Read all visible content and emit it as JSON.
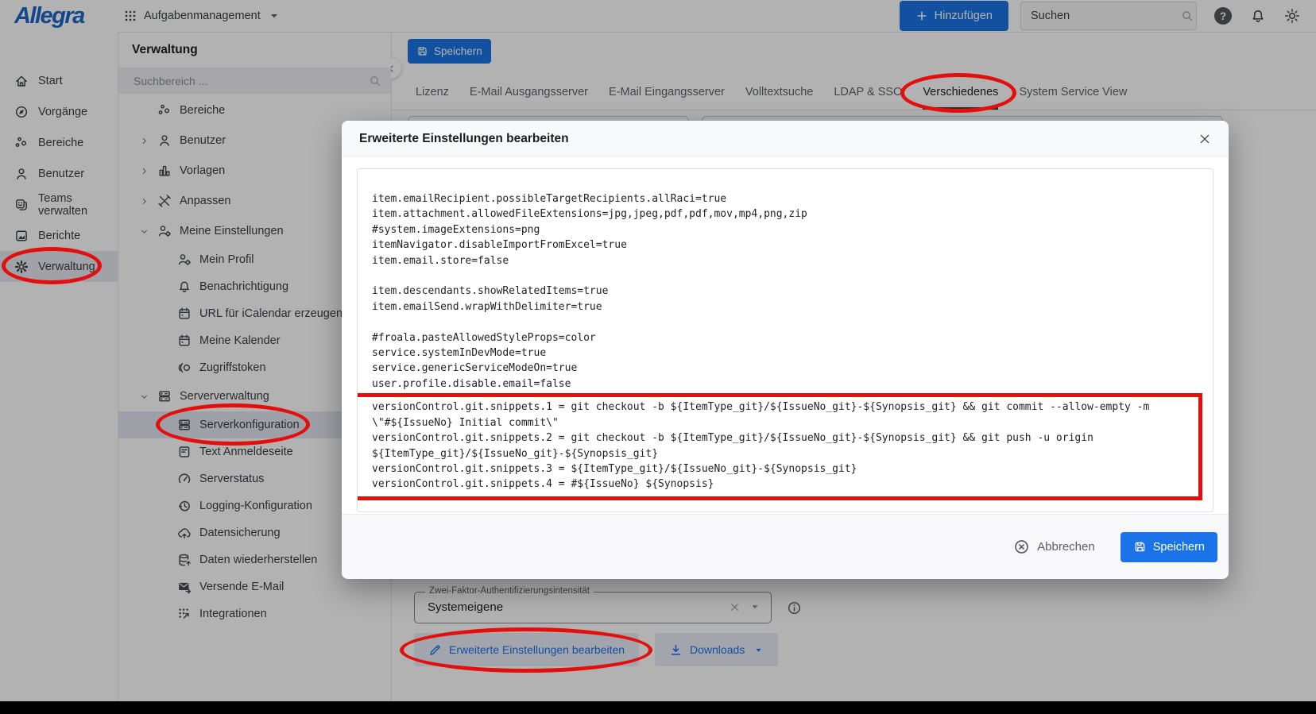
{
  "topbar": {
    "logo": "Allegra",
    "workspace_switcher": {
      "label": "Aufgabenmanagement",
      "icon": "apps-grid"
    },
    "add_button": {
      "label": "Hinzufügen",
      "icon": "plus"
    },
    "search": {
      "placeholder": "Suchen",
      "icon": "search"
    },
    "icons": [
      "help",
      "bell",
      "brightness"
    ]
  },
  "left_nav": {
    "items": [
      {
        "label": "Start",
        "icon": "home"
      },
      {
        "label": "Vorgänge",
        "icon": "compass"
      },
      {
        "label": "Bereiche",
        "icon": "dots-cluster"
      },
      {
        "label": "Benutzer",
        "icon": "person"
      },
      {
        "label": "Teams verwalten",
        "icon": "masks"
      },
      {
        "label": "Berichte",
        "icon": "report-image"
      },
      {
        "label": "Verwaltung",
        "icon": "gear",
        "selected": true
      }
    ]
  },
  "admin_panel": {
    "title": "Verwaltung",
    "search_placeholder": "Suchbereich ...",
    "tree": [
      {
        "label": "Bereiche",
        "icon": "dots-cluster",
        "level": 0,
        "expand": "none"
      },
      {
        "label": "Benutzer",
        "icon": "person",
        "level": 0,
        "expand": "collapsed"
      },
      {
        "label": "Vorlagen",
        "icon": "chart-bars",
        "level": 0,
        "expand": "collapsed"
      },
      {
        "label": "Anpassen",
        "icon": "tools",
        "level": 0,
        "expand": "collapsed"
      },
      {
        "label": "Meine Einstellungen",
        "icon": "person-gear",
        "level": 0,
        "expand": "expanded"
      },
      {
        "label": "Mein Profil",
        "icon": "person-gear",
        "level": 1
      },
      {
        "label": "Benachrichtigung",
        "icon": "bell",
        "level": 1
      },
      {
        "label": "URL für iCalendar erzeugen",
        "icon": "calendar",
        "level": 1
      },
      {
        "label": "Meine Kalender",
        "icon": "calendar",
        "level": 1
      },
      {
        "label": "Zugriffstoken",
        "icon": "token",
        "level": 1
      },
      {
        "label": "Serververwaltung",
        "icon": "server",
        "level": 0,
        "expand": "expanded"
      },
      {
        "label": "Serverkonfiguration",
        "icon": "server",
        "level": 1,
        "selected": true
      },
      {
        "label": "Text Anmeldeseite",
        "icon": "document",
        "level": 1
      },
      {
        "label": "Serverstatus",
        "icon": "gauge",
        "level": 1
      },
      {
        "label": "Logging-Konfiguration",
        "icon": "history",
        "level": 1
      },
      {
        "label": "Datensicherung",
        "icon": "cloud-upload",
        "level": 1
      },
      {
        "label": "Daten wiederherstellen",
        "icon": "database-restore",
        "level": 1
      },
      {
        "label": "Versende E-Mail",
        "icon": "mail-send",
        "level": 1
      },
      {
        "label": "Integrationen",
        "icon": "integrations",
        "level": 1
      }
    ]
  },
  "main": {
    "save_button": {
      "label": "Speichern",
      "icon": "save"
    },
    "tabs": [
      "Lizenz",
      "E-Mail Ausgangsserver",
      "E-Mail Eingangsserver",
      "Volltextsuche",
      "LDAP & SSO",
      "Verschiedenes",
      "System Service View"
    ],
    "active_tab": "Verschiedenes",
    "two_factor_field": {
      "label": "Zwei-Faktor-Authentifizierungsintensität",
      "value": "Systemeigene"
    },
    "edit_advanced_button": {
      "label": "Erweiterte Einstellungen bearbeiten",
      "icon": "pencil"
    },
    "downloads_button": {
      "label": "Downloads",
      "icon": "download"
    }
  },
  "modal": {
    "title": "Erweiterte Einstellungen bearbeiten",
    "config_lines": [
      "item.emailRecipient.possibleTargetRecipients.allRaci=true",
      "item.attachment.allowedFileExtensions=jpg,jpeg,pdf,pdf,mov,mp4,png,zip",
      "#system.imageExtensions=png",
      "itemNavigator.disableImportFromExcel=true",
      "item.email.store=false",
      "",
      "item.descendants.showRelatedItems=true",
      "item.emailSend.wrapWithDelimiter=true",
      "",
      "#froala.pasteAllowedStyleProps=color",
      "service.systemInDevMode=true",
      "service.genericServiceModeOn=true",
      "user.profile.disable.email=false"
    ],
    "highlighted_lines": [
      "versionControl.git.snippets.1 = git checkout -b ${ItemType_git}/${IssueNo_git}-${Synopsis_git} && git commit --allow-empty -m \\\"#${IssueNo} Initial commit\\\"",
      "versionControl.git.snippets.2 = git checkout -b ${ItemType_git}/${IssueNo_git}-${Synopsis_git} && git push -u origin ${ItemType_git}/${IssueNo_git}-${Synopsis_git}",
      "versionControl.git.snippets.3 = ${ItemType_git}/${IssueNo_git}-${Synopsis_git}",
      "versionControl.git.snippets.4 = #${IssueNo} ${Synopsis}"
    ],
    "cancel_button": {
      "label": "Abbrechen",
      "icon": "circle-x"
    },
    "save_button": {
      "label": "Speichern",
      "icon": "save"
    }
  },
  "colors": {
    "brand_blue": "#1a66c8",
    "primary_button_blue": "#1b74e4",
    "modal_save_blue": "#1a73e8",
    "annotation_red": "#e30f0c",
    "selected_row_bg": "#e2e5f0",
    "active_tab_underline": "#3f4246"
  }
}
